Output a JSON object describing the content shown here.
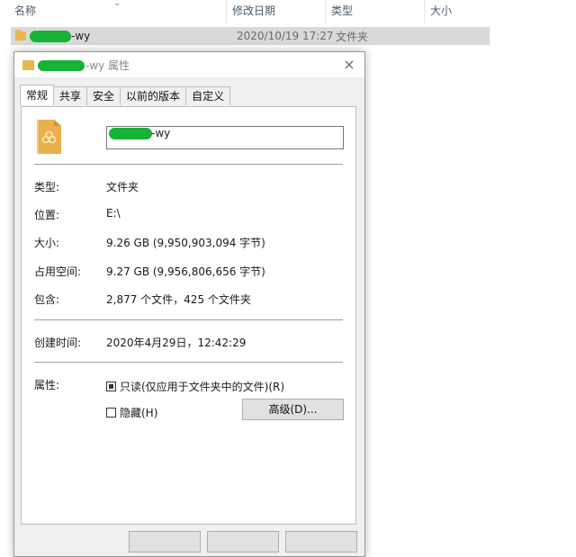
{
  "explorer": {
    "columns": {
      "name": "名称",
      "date": "修改日期",
      "type": "类型",
      "size": "大小"
    },
    "row": {
      "name_suffix": "-wy",
      "date": "2020/10/19 17:27",
      "type": "文件夹"
    }
  },
  "dialog": {
    "title_suffix": "-wy 属性",
    "close_glyph": "×",
    "tabs": [
      "常规",
      "共享",
      "安全",
      "以前的版本",
      "自定义"
    ],
    "name_suffix": "-wy",
    "props": {
      "type_label": "类型:",
      "type_value": "文件夹",
      "location_label": "位置:",
      "location_value": "E:\\",
      "size_label": "大小:",
      "size_value": "9.26 GB (9,950,903,094 字节)",
      "disk_label": "占用空间:",
      "disk_value": "9.27 GB (9,956,806,656 字节)",
      "contains_label": "包含:",
      "contains_value": "2,877 个文件，425 个文件夹",
      "created_label": "创建时间:",
      "created_value": "2020年4月29日，12:42:29",
      "attrs_label": "属性:",
      "readonly_label": "只读(仅应用于文件夹中的文件)(R)",
      "hidden_label": "隐藏(H)",
      "advanced_label": "高级(D)..."
    }
  },
  "colors": {
    "redaction": "#17b336",
    "folder": "#e9b64c",
    "selection": "#d9d9d9"
  }
}
